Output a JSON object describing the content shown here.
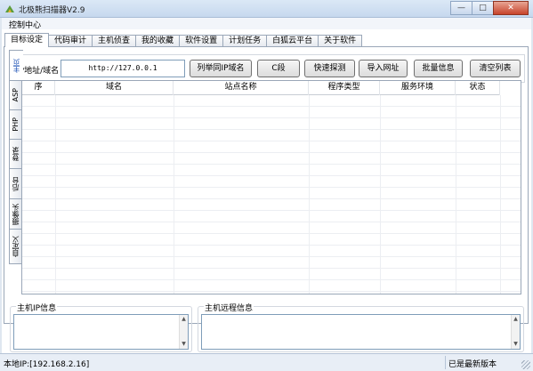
{
  "window": {
    "title": "北极熊扫描器V2.9",
    "minimize_glyph": "—",
    "maximize_glyph": "□",
    "close_glyph": "✕"
  },
  "menu": {
    "control_center": "控制中心"
  },
  "tabs": [
    "目标设定",
    "代码审计",
    "主机侦查",
    "我的收藏",
    "软件设置",
    "计划任务",
    "白狐云平台",
    "关于软件"
  ],
  "target": {
    "ip_label": "IP地址/域名",
    "ip_value": "http://127.0.0.1",
    "buttons": [
      "列举同IP域名",
      "C段",
      "快速探测",
      "导入网址",
      "批量信息",
      "清空列表"
    ]
  },
  "side_tabs": [
    "主页",
    "ASP",
    "PHP",
    "登录",
    "后台",
    "摄像头",
    "自定义"
  ],
  "table": {
    "columns": [
      "序",
      "域名",
      "站点名称",
      "程序类型",
      "服务环境",
      "状态"
    ]
  },
  "panels": {
    "host_ip_info": "主机IP信息",
    "host_remote_info": "主机远程信息"
  },
  "status": {
    "local_ip": "本地IP:[192.168.2.16]",
    "version_msg": "已是最新版本"
  },
  "icons": [
    "app-icon",
    "minimize-icon",
    "maximize-icon",
    "close-icon",
    "scroll-up-icon",
    "scroll-down-icon",
    "resize-grip-icon"
  ]
}
